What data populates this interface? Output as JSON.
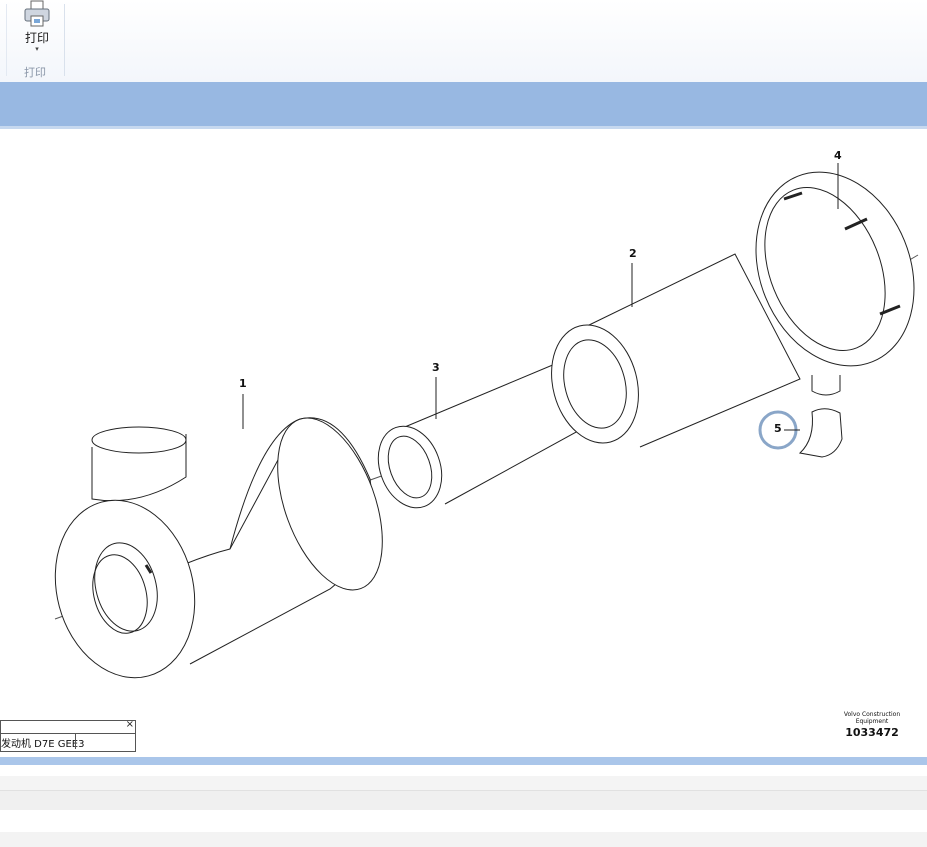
{
  "ribbon": {
    "print_label": "打印",
    "print_icon": "printer-icon",
    "group_label": "打印"
  },
  "drawing": {
    "callouts": [
      "1",
      "2",
      "3",
      "4",
      "5"
    ],
    "brand": "Volvo Construction Equipment",
    "part_number": "1033472",
    "highlight_color": "#8aa6c8"
  },
  "mini_window": {
    "close": "×",
    "text": "发动机 D7E GEE3"
  }
}
